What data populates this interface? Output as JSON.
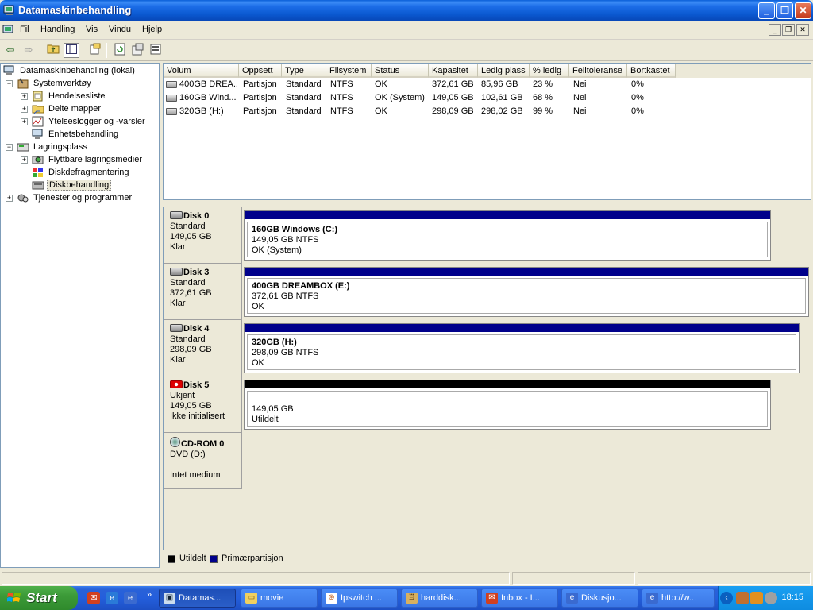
{
  "window": {
    "title": "Datamaskinbehandling",
    "minimize": "_",
    "maximize": "❐",
    "close": "✕"
  },
  "menu": {
    "items": [
      "Fil",
      "Handling",
      "Vis",
      "Vindu",
      "Hjelp"
    ]
  },
  "tree": {
    "root": "Datamaskinbehandling (lokal)",
    "items": [
      {
        "label": "Systemverktøy",
        "icon": "tools-icon"
      },
      {
        "label": "Hendelsesliste",
        "icon": "event-viewer-icon"
      },
      {
        "label": "Delte mapper",
        "icon": "shared-folder-icon"
      },
      {
        "label": "Ytelseslogger og -varsler",
        "icon": "performance-icon"
      },
      {
        "label": "Enhetsbehandling",
        "icon": "device-manager-icon"
      },
      {
        "label": "Lagringsplass",
        "icon": "storage-icon"
      },
      {
        "label": "Flyttbare lagringsmedier",
        "icon": "removable-storage-icon"
      },
      {
        "label": "Diskdefragmentering",
        "icon": "defrag-icon"
      },
      {
        "label": "Diskbehandling",
        "icon": "disk-management-icon"
      },
      {
        "label": "Tjenester og programmer",
        "icon": "services-icon"
      }
    ]
  },
  "volumes": {
    "columns": [
      "Volum",
      "Oppsett",
      "Type",
      "Filsystem",
      "Status",
      "Kapasitet",
      "Ledig plass",
      "% ledig",
      "Feiltoleranse",
      "Bortkastet"
    ],
    "rows": [
      [
        "400GB DREA...",
        "Partisjon",
        "Standard",
        "NTFS",
        "OK",
        "372,61 GB",
        "85,96 GB",
        "23 %",
        "Nei",
        "0%"
      ],
      [
        "160GB Wind...",
        "Partisjon",
        "Standard",
        "NTFS",
        "OK (System)",
        "149,05 GB",
        "102,61 GB",
        "68 %",
        "Nei",
        "0%"
      ],
      [
        "320GB (H:)",
        "Partisjon",
        "Standard",
        "NTFS",
        "OK",
        "298,09 GB",
        "298,02 GB",
        "99 %",
        "Nei",
        "0%"
      ]
    ]
  },
  "disks": [
    {
      "name": "Disk 0",
      "type": "Standard",
      "size": "149,05 GB",
      "status": "Klar",
      "part_name": "160GB Windows  (C:)",
      "part_size": "149,05 GB NTFS",
      "part_status": "OK (System)",
      "bar_color": "#00008b"
    },
    {
      "name": "Disk 3",
      "type": "Standard",
      "size": "372,61 GB",
      "status": "Klar",
      "part_name": "400GB DREAMBOX  (E:)",
      "part_size": "372,61 GB NTFS",
      "part_status": "OK",
      "bar_color": "#00008b"
    },
    {
      "name": "Disk 4",
      "type": "Standard",
      "size": "298,09 GB",
      "status": "Klar",
      "part_name": "320GB  (H:)",
      "part_size": "298,09 GB NTFS",
      "part_status": "OK",
      "bar_color": "#00008b"
    },
    {
      "name": "Disk 5",
      "type": "Ukjent",
      "size": "149,05 GB",
      "status": "Ikke initialisert",
      "part_name": "",
      "part_size": "149,05 GB",
      "part_status": "Utildelt",
      "bar_color": "#000000"
    }
  ],
  "cdrom": {
    "name": "CD-ROM 0",
    "type": "DVD (D:)",
    "status": "Intet medium"
  },
  "legend": {
    "unallocated": "Utildelt",
    "primary": "Primærpartisjon",
    "unallocated_color": "#000000",
    "primary_color": "#00008b"
  },
  "taskbar": {
    "start": "Start",
    "tasks": [
      "Datamas...",
      "movie",
      "Ipswitch ...",
      "harddisk...",
      "Inbox - I...",
      "Diskusjo...",
      "http://w..."
    ],
    "clock": "18:15"
  }
}
